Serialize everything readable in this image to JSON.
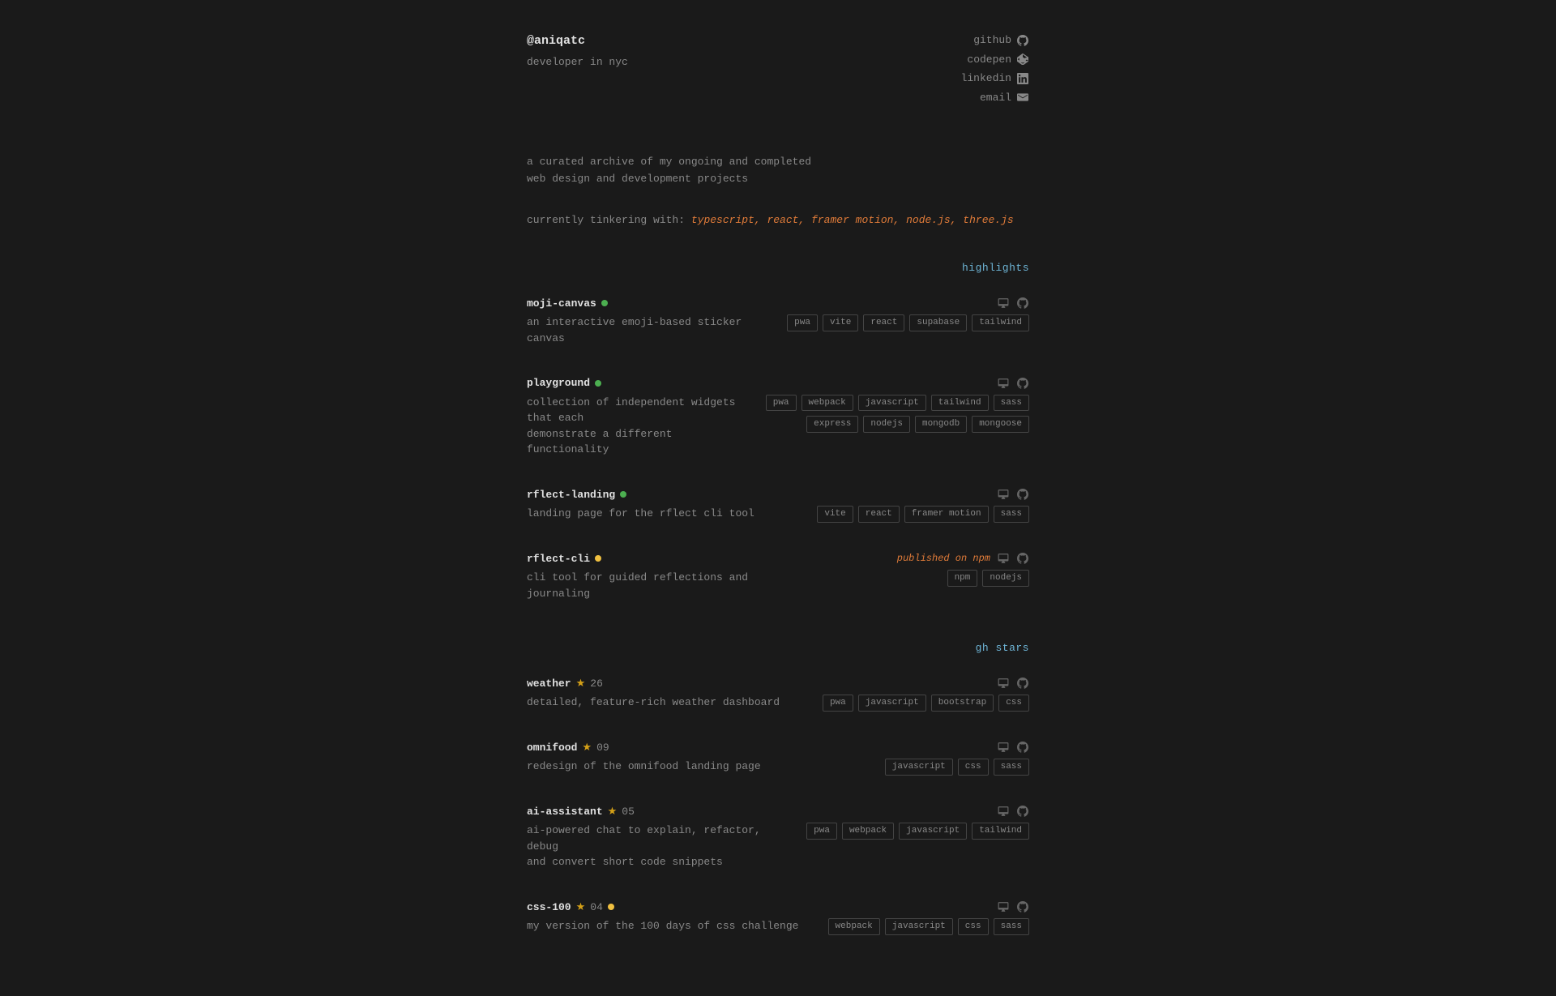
{
  "header": {
    "username": "@aniqatc",
    "tagline": "developer in nyc",
    "socials": [
      {
        "label": "github",
        "icon": "github-icon"
      },
      {
        "label": "codepen",
        "icon": "codepen-icon"
      },
      {
        "label": "linkedin",
        "icon": "linkedin-icon"
      },
      {
        "label": "email",
        "icon": "email-icon"
      }
    ]
  },
  "bio": {
    "line1": "a curated archive of my ongoing and completed",
    "line2": "web design and development projects"
  },
  "tinkering": {
    "prefix": "currently tinkering with: ",
    "items": "typescript, react, framer motion, node.js, three.js"
  },
  "highlights_section": {
    "label": "highlights",
    "projects": [
      {
        "name": "moji-canvas",
        "status": "green",
        "description": "an interactive emoji-based sticker canvas",
        "tags": [
          "pwa",
          "vite",
          "react",
          "supabase",
          "tailwind"
        ],
        "published": null
      },
      {
        "name": "playground",
        "status": "green",
        "description": "collection of independent widgets that each\ndemonstrate a different functionality",
        "tags_row1": [
          "pwa",
          "webpack",
          "javascript",
          "tailwind",
          "sass"
        ],
        "tags_row2": [
          "express",
          "nodejs",
          "mongodb",
          "mongoose"
        ],
        "published": null
      },
      {
        "name": "rflect-landing",
        "status": "green",
        "description": "landing page for the rflect cli tool",
        "tags": [
          "vite",
          "react",
          "framer motion",
          "sass"
        ],
        "published": null
      },
      {
        "name": "rflect-cli",
        "status": "yellow",
        "description": "cli tool for guided reflections and\njournaling",
        "tags": [
          "npm",
          "nodejs"
        ],
        "published": "published on npm"
      }
    ]
  },
  "gh_stars_section": {
    "label": "gh stars",
    "projects": [
      {
        "name": "weather",
        "stars": "26",
        "description": "detailed, feature-rich weather dashboard",
        "tags": [
          "pwa",
          "javascript",
          "bootstrap",
          "css"
        ]
      },
      {
        "name": "omnifood",
        "stars": "09",
        "description": "redesign of the omnifood landing page",
        "tags": [
          "javascript",
          "css",
          "sass"
        ]
      },
      {
        "name": "ai-assistant",
        "stars": "05",
        "description": "ai-powered chat to explain, refactor, debug\nand convert short code snippets",
        "tags": [
          "pwa",
          "webpack",
          "javascript",
          "tailwind"
        ]
      },
      {
        "name": "css-100",
        "stars": "04",
        "status": "yellow",
        "description": "my version of the 100 days of css challenge",
        "tags": [
          "webpack",
          "javascript",
          "css",
          "sass"
        ]
      }
    ]
  }
}
